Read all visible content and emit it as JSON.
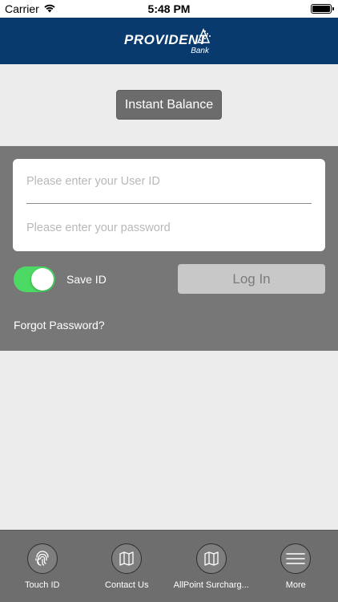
{
  "status": {
    "carrier": "Carrier",
    "time": "5:48 PM"
  },
  "header": {
    "logo_text": "PROVIDENT",
    "logo_sub": "Bank"
  },
  "instant_balance": {
    "label": "Instant Balance"
  },
  "login": {
    "user_placeholder": "Please enter your User ID",
    "password_placeholder": "Please enter your password",
    "save_id_label": "Save ID",
    "save_id_on": true,
    "login_label": "Log In",
    "forgot_label": "Forgot Password?"
  },
  "tabs": [
    {
      "label": "Touch ID",
      "icon": "fingerprint-icon"
    },
    {
      "label": "Contact Us",
      "icon": "map-icon"
    },
    {
      "label": "AllPoint Surcharg...",
      "icon": "map-icon"
    },
    {
      "label": "More",
      "icon": "menu-icon"
    }
  ],
  "colors": {
    "header": "#083a6e",
    "panel": "#777777",
    "toggle_on": "#4cd964",
    "tab_bar": "#6e6e6e"
  }
}
